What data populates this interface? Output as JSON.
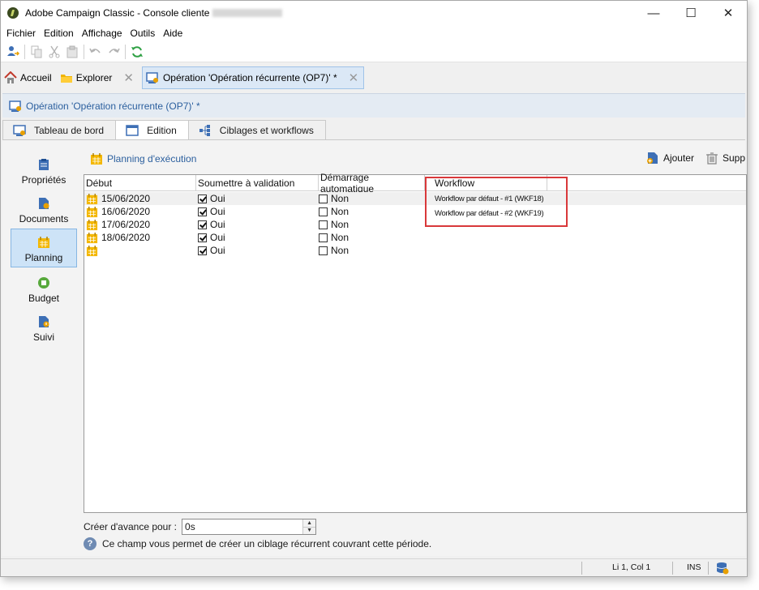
{
  "window": {
    "title": "Adobe Campaign Classic - Console cliente",
    "controls": {
      "minimize": "—",
      "maximize": "☐",
      "close": "✕"
    }
  },
  "menu": [
    "Fichier",
    "Edition",
    "Affichage",
    "Outils",
    "Aide"
  ],
  "toolbar": {
    "icons": [
      "user-connect-icon",
      "copy-icon",
      "cut-icon",
      "paste-icon",
      "undo-icon",
      "redo-icon",
      "refresh-icon"
    ]
  },
  "doc_tabs": {
    "home": "Accueil",
    "explorer": "Explorer",
    "close_glyph": "✕",
    "operation": "Opération 'Opération récurrente (OP7)' *"
  },
  "object_header": {
    "title": "Opération 'Opération récurrente (OP7)' *"
  },
  "view_tabs": [
    "Tableau de bord",
    "Edition",
    "Ciblages et workflows"
  ],
  "side_nav": [
    "Propriétés",
    "Documents",
    "Planning",
    "Budget",
    "Suivi"
  ],
  "planning": {
    "title": "Planning d'exécution",
    "add_label": "Ajouter",
    "delete_label": "Supp",
    "columns": [
      "Début",
      "Soumettre à validation",
      "Démarrage automatique",
      "Workflow"
    ],
    "rows": [
      {
        "start": "15/06/2020",
        "validation": "Oui",
        "validation_checked": true,
        "auto": "Non",
        "auto_checked": false,
        "workflow": "Workflow par défaut - #1 (WKF18)"
      },
      {
        "start": "16/06/2020",
        "validation": "Oui",
        "validation_checked": true,
        "auto": "Non",
        "auto_checked": false,
        "workflow": "Workflow par défaut - #2 (WKF19)"
      },
      {
        "start": "17/06/2020",
        "validation": "Oui",
        "validation_checked": true,
        "auto": "Non",
        "auto_checked": false,
        "workflow": ""
      },
      {
        "start": "18/06/2020",
        "validation": "Oui",
        "validation_checked": true,
        "auto": "Non",
        "auto_checked": false,
        "workflow": ""
      },
      {
        "start": "",
        "validation": "Oui",
        "validation_checked": true,
        "auto": "Non",
        "auto_checked": false,
        "workflow": ""
      }
    ]
  },
  "advance": {
    "label": "Créer d'avance pour :",
    "value": "0s"
  },
  "help": {
    "glyph": "?",
    "text": "Ce champ vous permet de créer un ciblage récurrent couvrant cette période."
  },
  "status": {
    "position": "Li 1, Col 1",
    "mode": "INS"
  },
  "colors": {
    "accent_blue": "#2b5f9e",
    "highlight_red": "#d9383a",
    "nav_active": "#cde3f7",
    "calendar_yellow": "#f3b700"
  }
}
